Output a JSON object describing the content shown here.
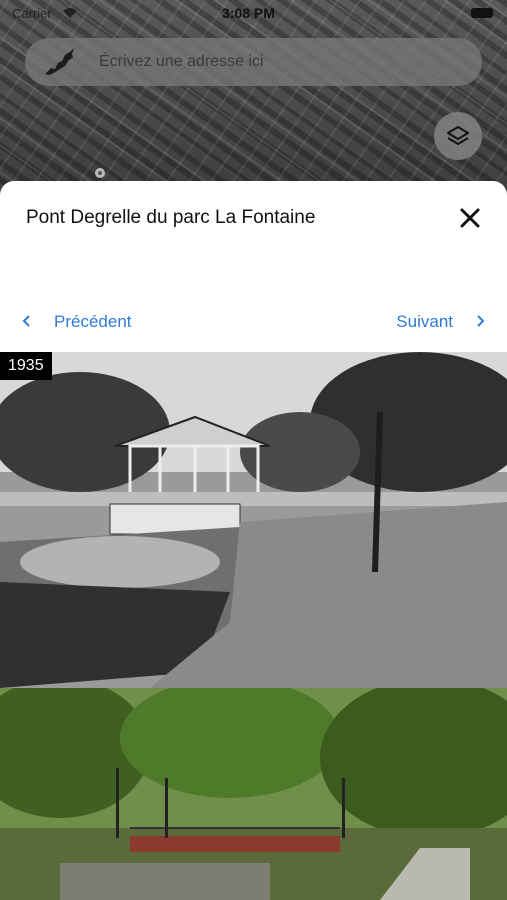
{
  "status_bar": {
    "carrier": "Carrier",
    "time": "3:08 PM"
  },
  "search": {
    "placeholder": "Écrivez une adresse ici"
  },
  "icons": {
    "logo": "montreal-island-icon",
    "layers": "layers-icon",
    "close": "close-icon",
    "prev": "chevron-left-icon",
    "next": "chevron-right-icon"
  },
  "sheet": {
    "title": "Pont Degrelle du parc La Fontaine",
    "prev_label": "Précédent",
    "next_label": "Suivant"
  },
  "photos": {
    "old_year": "1935"
  },
  "colors": {
    "accent": "#2f7bd6",
    "sheet_bg": "#ffffff",
    "badge_bg": "#000000"
  }
}
